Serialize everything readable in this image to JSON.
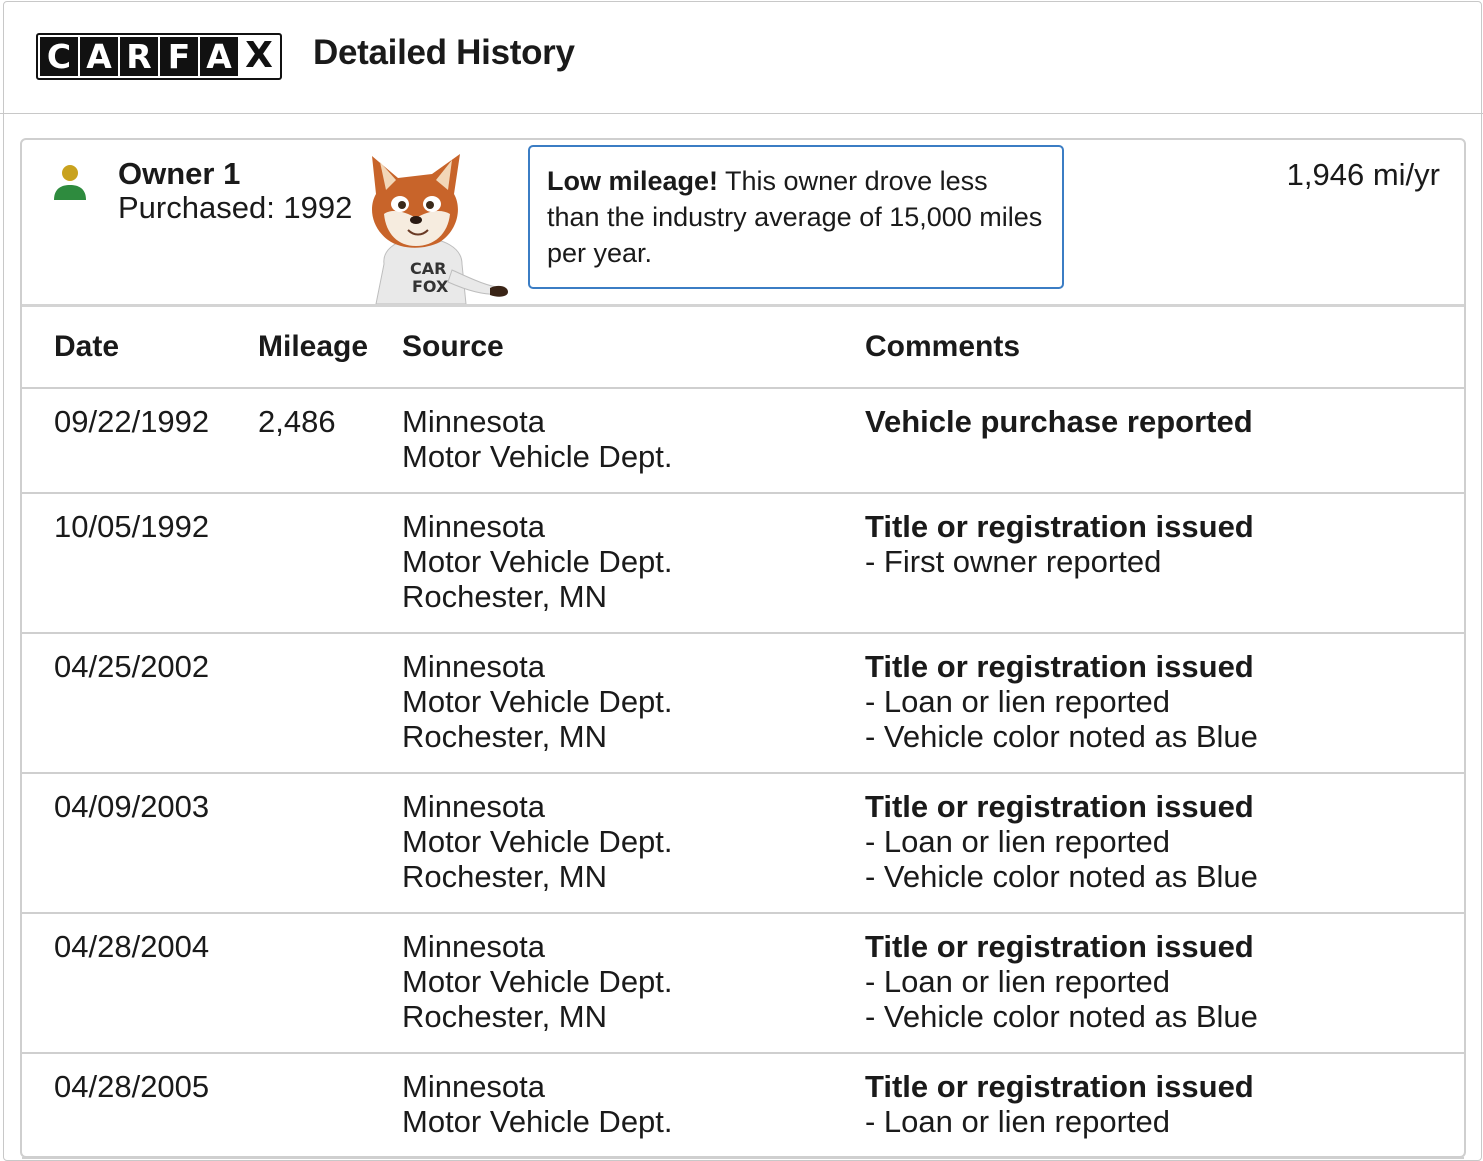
{
  "header": {
    "logo_letters": [
      "C",
      "A",
      "R",
      "F",
      "A",
      "X"
    ],
    "title": "Detailed History"
  },
  "owner": {
    "name": "Owner 1",
    "purchased": "Purchased: 1992",
    "rate": "1,946 mi/yr",
    "callout_bold": "Low mileage!",
    "callout_text": " This owner drove less than the industry average of 15,000 miles per year.",
    "mascot_shirt": "CAR FOX",
    "icon_colors": {
      "head": "#c9a21e",
      "body": "#2e8b3e"
    }
  },
  "table": {
    "columns": [
      "Date",
      "Mileage",
      "Source",
      "Comments"
    ],
    "rows": [
      {
        "date": "09/22/1992",
        "mileage": "2,486",
        "source": [
          "Minnesota",
          "Motor Vehicle Dept."
        ],
        "comment": "Vehicle purchase reported",
        "notes": []
      },
      {
        "date": "10/05/1992",
        "mileage": "",
        "source": [
          "Minnesota",
          "Motor Vehicle Dept.",
          "Rochester, MN"
        ],
        "comment": "Title or registration issued",
        "notes": [
          "- First owner reported"
        ]
      },
      {
        "date": "04/25/2002",
        "mileage": "",
        "source": [
          "Minnesota",
          "Motor Vehicle Dept.",
          "Rochester, MN"
        ],
        "comment": "Title or registration issued",
        "notes": [
          "- Loan or lien reported",
          "- Vehicle color noted as Blue"
        ]
      },
      {
        "date": "04/09/2003",
        "mileage": "",
        "source": [
          "Minnesota",
          "Motor Vehicle Dept.",
          "Rochester, MN"
        ],
        "comment": "Title or registration issued",
        "notes": [
          "- Loan or lien reported",
          "- Vehicle color noted as Blue"
        ]
      },
      {
        "date": "04/28/2004",
        "mileage": "",
        "source": [
          "Minnesota",
          "Motor Vehicle Dept.",
          "Rochester, MN"
        ],
        "comment": "Title or registration issued",
        "notes": [
          "- Loan or lien reported",
          "- Vehicle color noted as Blue"
        ]
      },
      {
        "date": "04/28/2005",
        "mileage": "",
        "source": [
          "Minnesota",
          "Motor Vehicle Dept."
        ],
        "comment": "Title or registration issued",
        "notes": [
          "- Loan or lien reported"
        ]
      }
    ]
  }
}
